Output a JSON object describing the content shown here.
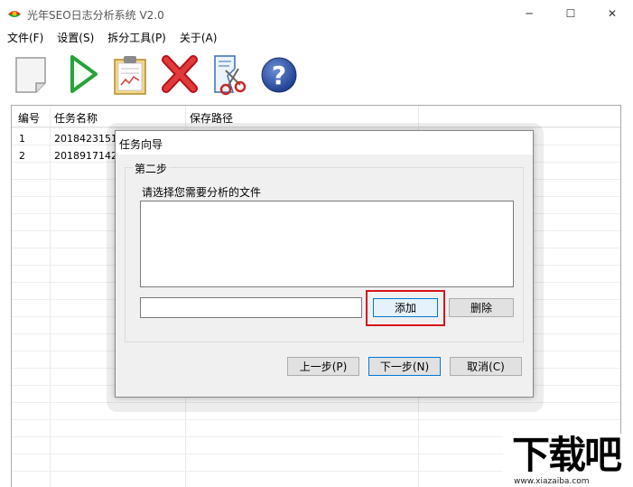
{
  "window": {
    "title": "光年SEO日志分析系统 V2.0",
    "controls": {
      "minimize": "─",
      "maximize": "☐",
      "close": "✕"
    }
  },
  "menu": {
    "items": [
      {
        "label": "文件(F)"
      },
      {
        "label": "设置(S)"
      },
      {
        "label": "拆分工具(P)"
      },
      {
        "label": "关于(A)"
      }
    ]
  },
  "toolbar": {
    "buttons": [
      {
        "icon": "new-document-icon"
      },
      {
        "icon": "play-icon"
      },
      {
        "icon": "clipboard-report-icon"
      },
      {
        "icon": "delete-x-icon"
      },
      {
        "icon": "split-scissors-icon"
      },
      {
        "icon": "help-question-icon"
      }
    ],
    "help_glyph": "?"
  },
  "tasklist": {
    "columns": [
      "编号",
      "任务名称",
      "保存路径"
    ],
    "rows": [
      {
        "id": "1",
        "name": "201842315100"
      },
      {
        "id": "2",
        "name": "201891714200"
      }
    ]
  },
  "dialog": {
    "title": "任务向导",
    "step_label": "第二步",
    "prompt": "请选择您需要分析的文件",
    "path_value": "",
    "add_label": "添加",
    "delete_label": "删除",
    "prev_label": "上一步(P)",
    "next_label": "下一步(N)",
    "cancel_label": "取消(C)"
  },
  "watermark": {
    "brand": "下载吧",
    "url": "www.xiazaiba.com"
  },
  "colors": {
    "accent": "#0078d7",
    "highlight": "#d4141c",
    "dialog_bg": "#f0f0f0"
  }
}
